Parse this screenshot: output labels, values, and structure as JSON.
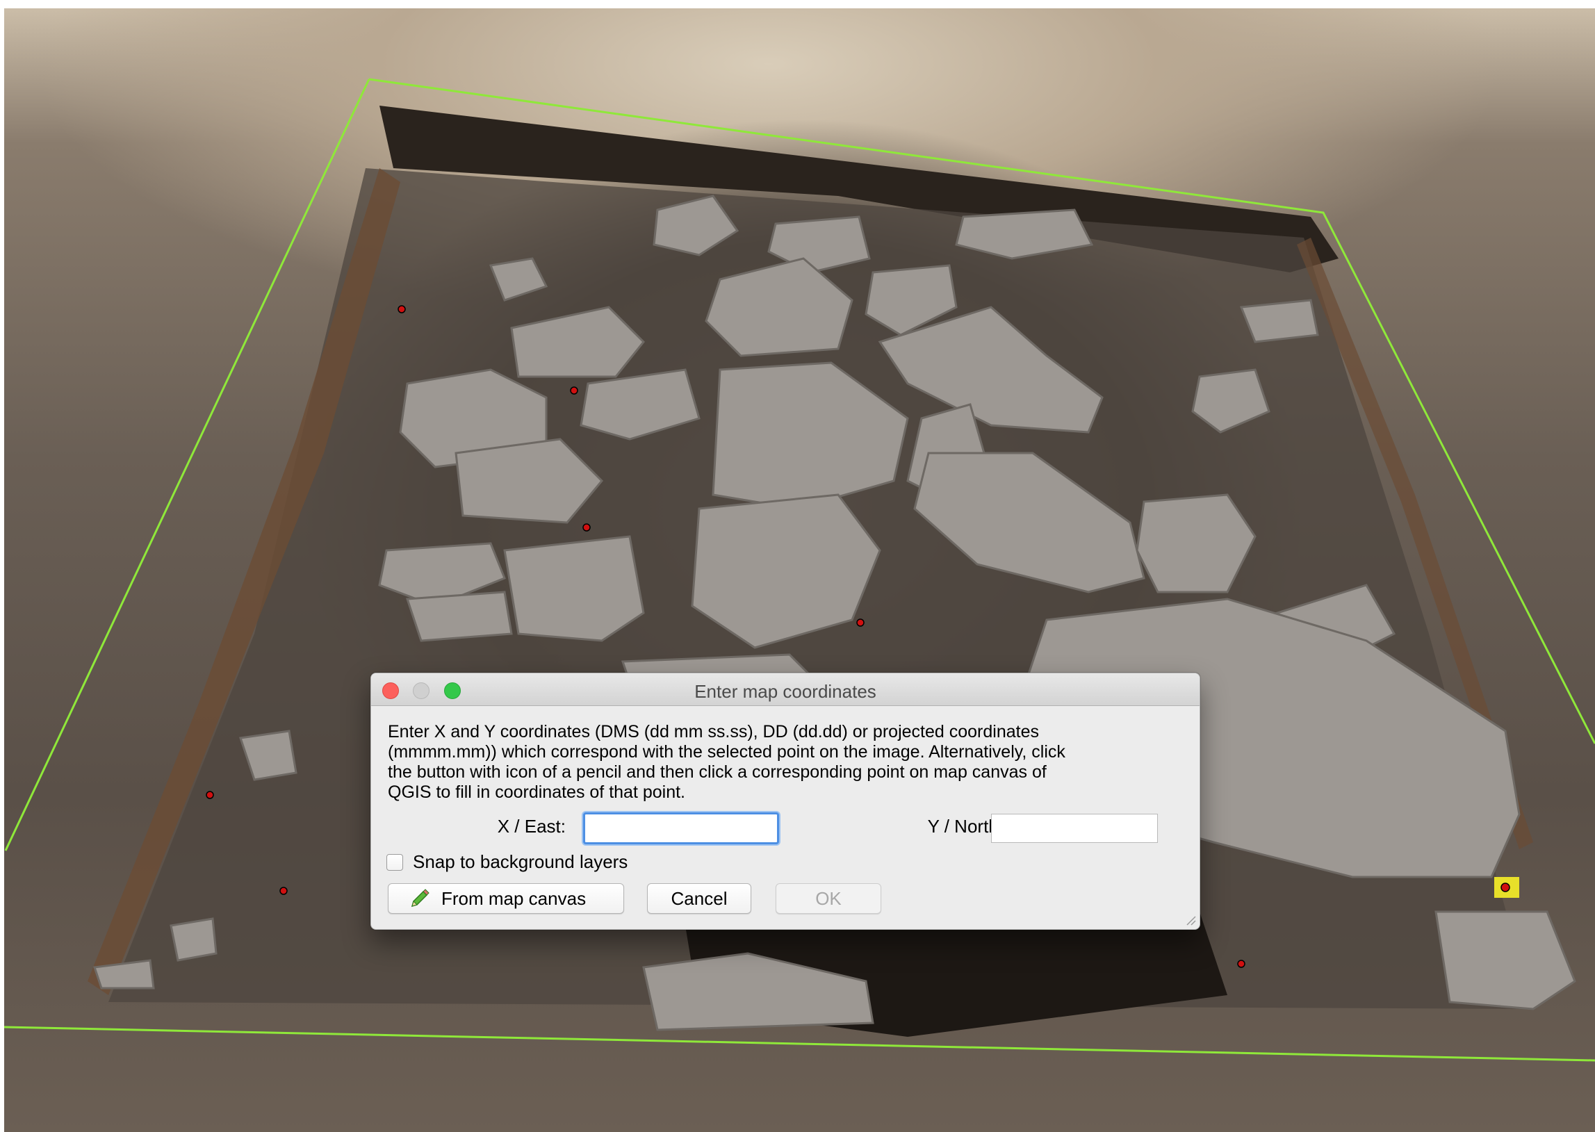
{
  "dialog": {
    "title": "Enter map coordinates",
    "instructions": "Enter X and Y coordinates (DMS (dd mm ss.ss), DD (dd.dd) or projected coordinates\n(mmmm.mm)) which correspond with the selected point on the image. Alternatively, click\nthe button with icon of a pencil and then click a corresponding point on map canvas of\nQGIS to fill in coordinates of that point.",
    "x_label": "X / East:",
    "x_value": "",
    "y_label": "Y / North:",
    "y_value": "",
    "snap_label": "Snap to background layers",
    "snap_checked": false,
    "from_canvas_label": "From map canvas",
    "cancel_label": "Cancel",
    "ok_label": "OK",
    "ok_enabled": false
  },
  "window_controls": [
    "close-icon",
    "minimize-icon",
    "zoom-icon"
  ],
  "icons": {
    "from_canvas": "pencil-icon"
  },
  "colors": {
    "boundary_string": "#8fe83a",
    "close": "#fc605c",
    "zoom": "#34c84a",
    "focus_ring": "#4d8fe3",
    "gcp_marker": "#d01010"
  }
}
